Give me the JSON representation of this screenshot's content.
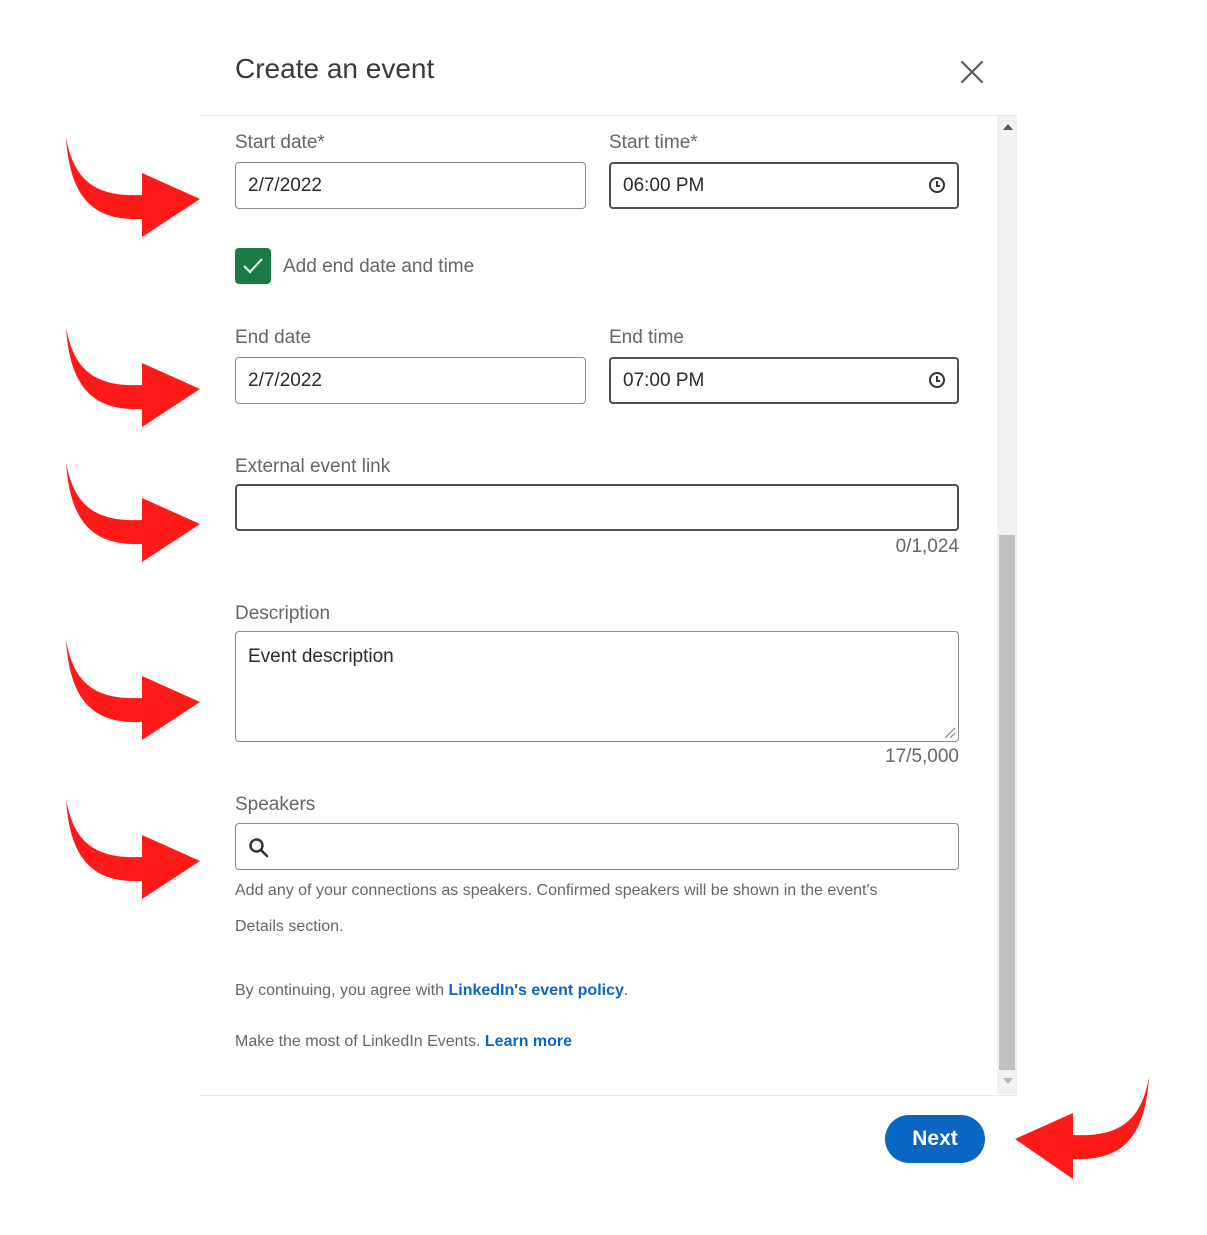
{
  "dialog": {
    "title": "Create an event",
    "close_icon": "close-icon"
  },
  "form": {
    "start_date": {
      "label": "Start date*",
      "value": "2/7/2022"
    },
    "start_time": {
      "label": "Start time*",
      "value": "06:00 PM"
    },
    "add_end": {
      "label": "Add end date and time",
      "checked": true
    },
    "end_date": {
      "label": "End date",
      "value": "2/7/2022"
    },
    "end_time": {
      "label": "End time",
      "value": "07:00 PM"
    },
    "external_link": {
      "label": "External event link",
      "value": "",
      "counter": "0/1,024"
    },
    "description": {
      "label": "Description",
      "value": "Event description",
      "counter": "17/5,000"
    },
    "speakers": {
      "label": "Speakers",
      "value": "",
      "helper_line1": "Add any of your connections as speakers. Confirmed speakers will be shown in the event's",
      "helper_line2": "Details section."
    },
    "policy": {
      "prefix": "By continuing, you agree with ",
      "link": "LinkedIn's event policy",
      "suffix": "."
    },
    "learn": {
      "prefix": "Make the most of LinkedIn Events. ",
      "link": "Learn more"
    }
  },
  "footer": {
    "next_label": "Next"
  },
  "colors": {
    "accent": "#0a66c2",
    "checkbox": "#1a7a45",
    "annotation_arrow": "#ff1a1a"
  }
}
